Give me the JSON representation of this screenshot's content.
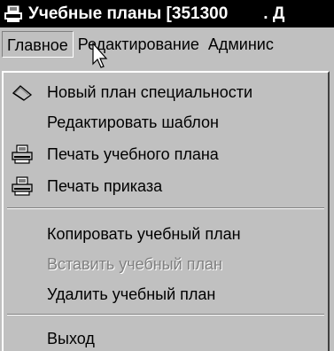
{
  "window": {
    "title_main": "Учебные планы [351300",
    "title_rest": ". Д",
    "icon": "printer-app-icon"
  },
  "menubar": {
    "items": [
      {
        "label": "Главное",
        "active": true
      },
      {
        "label": "Редактирование",
        "active": false
      },
      {
        "label": "Админис",
        "active": false
      }
    ]
  },
  "menu": {
    "items": [
      {
        "label": "Новый  план специальности",
        "icon": "new-plan-icon",
        "enabled": true
      },
      {
        "label": "Редактировать шаблон",
        "icon": "",
        "enabled": true
      },
      {
        "label": "Печать учебного плана",
        "icon": "printer-icon",
        "enabled": true
      },
      {
        "label": "Печать приказа",
        "icon": "printer-icon",
        "enabled": true
      },
      {
        "label": "Копировать учебный план",
        "icon": "",
        "enabled": true
      },
      {
        "label": "Вставить учебный план",
        "icon": "",
        "enabled": false
      },
      {
        "label": "Удалить учебный план",
        "icon": "",
        "enabled": true
      },
      {
        "label": "Выход",
        "icon": "",
        "enabled": true
      }
    ]
  },
  "colors": {
    "titlebar_bg": "#000000",
    "menu_bg": "#c0c0c0",
    "disabled_text": "#808080"
  }
}
